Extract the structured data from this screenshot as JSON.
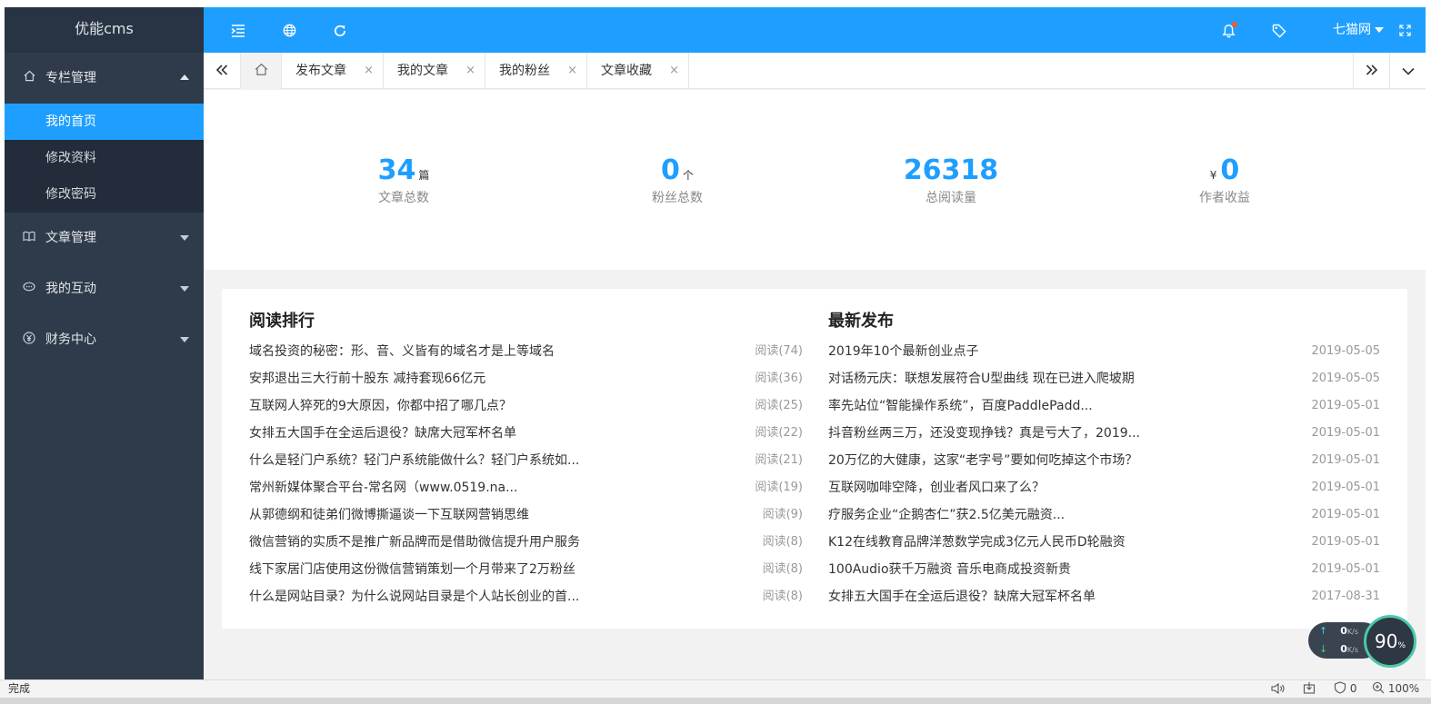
{
  "app": {
    "logo": "优能cms"
  },
  "sidebar": {
    "groups": [
      {
        "label": "专栏管理",
        "icon": "home-icon",
        "expanded": true,
        "items": [
          {
            "label": "我的首页",
            "active": true
          },
          {
            "label": "修改资料"
          },
          {
            "label": "修改密码"
          }
        ]
      },
      {
        "label": "文章管理",
        "icon": "book-icon"
      },
      {
        "label": "我的互动",
        "icon": "chat-icon"
      },
      {
        "label": "财务中心",
        "icon": "yen-icon"
      }
    ]
  },
  "header": {
    "user": "七猫网",
    "colors": {
      "accent": "#1e9fff",
      "sidebar": "#2f3b4b",
      "notification_dot": "#ff5722"
    }
  },
  "tabs": {
    "items": [
      {
        "label": "发布文章"
      },
      {
        "label": "我的文章"
      },
      {
        "label": "我的粉丝"
      },
      {
        "label": "文章收藏"
      }
    ],
    "close_glyph": "×"
  },
  "stats": [
    {
      "value": "34",
      "unit": "篇",
      "label": "文章总数"
    },
    {
      "value": "0",
      "unit": "个",
      "label": "粉丝总数"
    },
    {
      "value": "26318",
      "label": "总阅读量"
    },
    {
      "value": "0",
      "prefix": "¥",
      "label": "作者收益"
    }
  ],
  "ranking": {
    "title": "阅读排行",
    "rows": [
      {
        "title": "域名投资的秘密：形、音、义皆有的域名才是上等域名",
        "reads": "阅读(74)"
      },
      {
        "title": "安邦退出三大行前十股东 减持套现66亿元",
        "reads": "阅读(36)"
      },
      {
        "title": "互联网人猝死的9大原因，你都中招了哪几点？",
        "reads": "阅读(25)"
      },
      {
        "title": "女排五大国手在全运后退役？缺席大冠军杯名单",
        "reads": "阅读(22)"
      },
      {
        "title": "什么是轻门户系统？轻门户系统能做什么？轻门户系统如...",
        "reads": "阅读(21)"
      },
      {
        "title": "常州新媒体聚合平台-常名网（www.0519.na...",
        "reads": "阅读(19)"
      },
      {
        "title": "从郭德纲和徒弟们微博撕逼谈一下互联网营销思维",
        "reads": "阅读(9)"
      },
      {
        "title": "微信营销的实质不是推广新品牌而是借助微信提升用户服务",
        "reads": "阅读(8)"
      },
      {
        "title": "线下家居门店使用这份微信营销策划一个月带来了2万粉丝",
        "reads": "阅读(8)"
      },
      {
        "title": "什么是网站目录？为什么说网站目录是个人站长创业的首...",
        "reads": "阅读(8)"
      }
    ]
  },
  "latest": {
    "title": "最新发布",
    "rows": [
      {
        "title": "2019年10个最新创业点子",
        "date": "2019-05-05"
      },
      {
        "title": "对话杨元庆：联想发展符合U型曲线 现在已进入爬坡期",
        "date": "2019-05-05"
      },
      {
        "title": "率先站位“智能操作系统”，百度PaddlePadd...",
        "date": "2019-05-01"
      },
      {
        "title": "抖音粉丝两三万，还没变现挣钱？真是亏大了，2019...",
        "date": "2019-05-01"
      },
      {
        "title": "20万亿的大健康，这家“老字号”要如何吃掉这个市场？",
        "date": "2019-05-01"
      },
      {
        "title": "互联网咖啡空降，创业者风口来了么？",
        "date": "2019-05-01"
      },
      {
        "title": "疗服务企业“企鹅杏仁”获2.5亿美元融资...",
        "date": "2019-05-01"
      },
      {
        "title": "K12在线教育品牌洋葱数学完成3亿元人民币D轮融资",
        "date": "2019-05-01"
      },
      {
        "title": "100Audio获千万融资 音乐电商成投资新贵",
        "date": "2019-05-01"
      },
      {
        "title": "女排五大国手在全运后退役？缺席大冠军杯名单",
        "date": "2017-08-31"
      }
    ]
  },
  "statusbar": {
    "status": "完成",
    "blocked": "0",
    "zoom": "100%"
  },
  "speed": {
    "up": "0",
    "down": "0",
    "unit": "K/s",
    "gauge": "90",
    "gauge_unit": "%"
  }
}
